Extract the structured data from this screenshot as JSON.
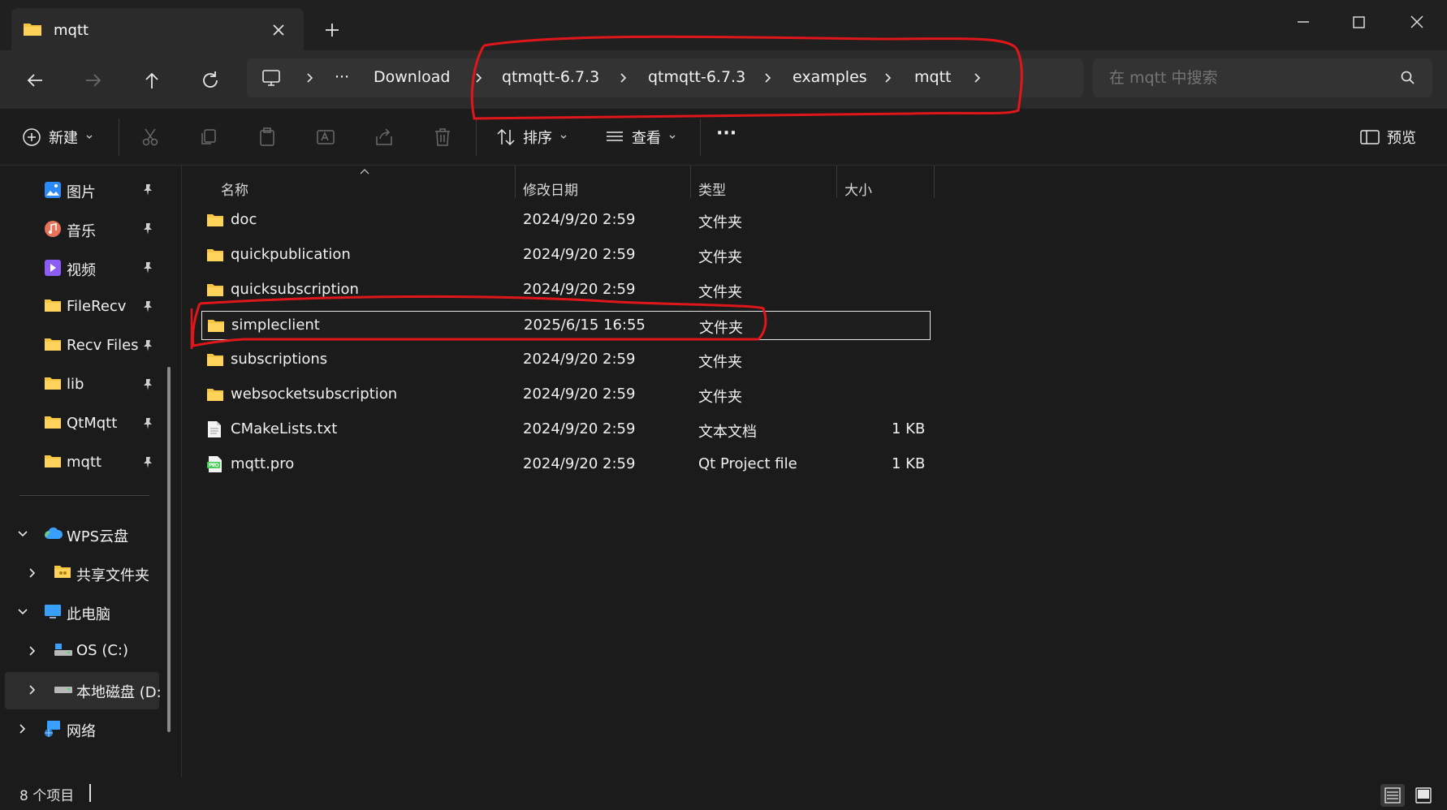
{
  "window": {
    "tab_title": "mqtt",
    "new_tab": "+"
  },
  "address": {
    "crumbs": [
      "Download",
      "qtmqtt-6.7.3",
      "qtmqtt-6.7.3",
      "examples",
      "mqtt"
    ],
    "overflow": "···",
    "search_placeholder": "在 mqtt 中搜索"
  },
  "toolbar": {
    "new_label": "新建",
    "sort_label": "排序",
    "view_label": "查看",
    "more_label": "···",
    "preview_label": "预览"
  },
  "sidebar": {
    "pinned": [
      {
        "label": "图片",
        "icon": "pictures-icon"
      },
      {
        "label": "音乐",
        "icon": "music-icon"
      },
      {
        "label": "视频",
        "icon": "videos-icon"
      },
      {
        "label": "FileRecv",
        "icon": "folder-icon"
      },
      {
        "label": "Recv Files",
        "icon": "folder-icon"
      },
      {
        "label": "lib",
        "icon": "folder-icon"
      },
      {
        "label": "QtMqtt",
        "icon": "folder-icon"
      },
      {
        "label": "mqtt",
        "icon": "folder-icon"
      }
    ],
    "tree": [
      {
        "label": "WPS云盘",
        "icon": "cloud-icon",
        "expanded": true
      },
      {
        "label": "共享文件夹",
        "icon": "shared-folder-icon",
        "expanded": false
      },
      {
        "label": "此电脑",
        "icon": "computer-icon",
        "expanded": true
      },
      {
        "label": "OS (C:)",
        "icon": "os-drive-icon",
        "expanded": false
      },
      {
        "label": "本地磁盘 (D:",
        "icon": "drive-icon",
        "expanded": false
      },
      {
        "label": "网络",
        "icon": "network-icon",
        "expanded": false
      }
    ]
  },
  "columns": {
    "name": "名称",
    "modified": "修改日期",
    "type": "类型",
    "size": "大小"
  },
  "files": [
    {
      "name": "doc",
      "modified": "2024/9/20 2:59",
      "type": "文件夹",
      "size": "",
      "icon": "folder-icon"
    },
    {
      "name": "quickpublication",
      "modified": "2024/9/20 2:59",
      "type": "文件夹",
      "size": "",
      "icon": "folder-icon"
    },
    {
      "name": "quicksubscription",
      "modified": "2024/9/20 2:59",
      "type": "文件夹",
      "size": "",
      "icon": "folder-icon"
    },
    {
      "name": "simpleclient",
      "modified": "2025/6/15 16:55",
      "type": "文件夹",
      "size": "",
      "icon": "folder-icon",
      "selected": true
    },
    {
      "name": "subscriptions",
      "modified": "2024/9/20 2:59",
      "type": "文件夹",
      "size": "",
      "icon": "folder-icon"
    },
    {
      "name": "websocketsubscription",
      "modified": "2024/9/20 2:59",
      "type": "文件夹",
      "size": "",
      "icon": "folder-icon"
    },
    {
      "name": "CMakeLists.txt",
      "modified": "2024/9/20 2:59",
      "type": "文本文档",
      "size": "1 KB",
      "icon": "text-file-icon"
    },
    {
      "name": "mqtt.pro",
      "modified": "2024/9/20 2:59",
      "type": "Qt Project file",
      "size": "1 KB",
      "icon": "pro-file-icon"
    }
  ],
  "status": {
    "item_count": "8 个项目"
  },
  "colors": {
    "folder": "#f5c542",
    "annotation": "#e0161a",
    "accent": "#4cc2ff"
  }
}
